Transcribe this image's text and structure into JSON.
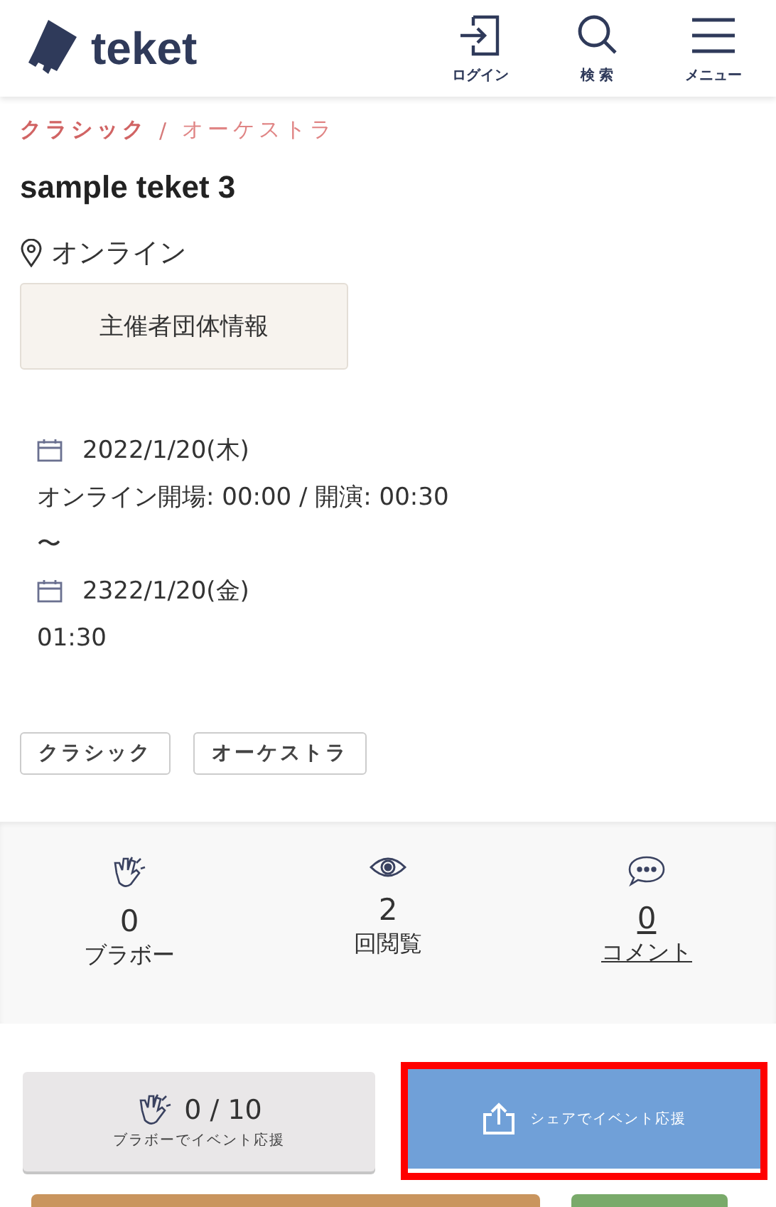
{
  "header": {
    "logo": "teket",
    "actions": [
      {
        "kind": "login",
        "label": "ログイン"
      },
      {
        "kind": "search",
        "label": "検 索"
      },
      {
        "kind": "menu",
        "label": "メニュー"
      }
    ]
  },
  "breadcrumb": [
    {
      "label": "クラシック",
      "current": false
    },
    {
      "label": "オーケストラ",
      "current": true
    }
  ],
  "breadcrumb_separator": "/",
  "title": "sample teket 3",
  "location": "オンライン",
  "organizer_button": "主催者団体情報",
  "schedule": [
    {
      "kind": "date",
      "text": "2022/1/20(木)"
    },
    {
      "kind": "text",
      "text": "オンライン開場: 00:00 / 開演: 00:30"
    },
    {
      "kind": "text",
      "text": "〜"
    },
    {
      "kind": "date",
      "text": "2322/1/20(金)"
    },
    {
      "kind": "text",
      "text": "01:30"
    }
  ],
  "tags": [
    "クラシック",
    "オーケストラ"
  ],
  "stats": [
    {
      "kind": "clap",
      "value": "0",
      "label": "ブラボー",
      "link": false
    },
    {
      "kind": "eye",
      "value": "2",
      "label": "回閲覧",
      "link": false
    },
    {
      "kind": "comment",
      "value": "0",
      "label": "コメント",
      "link": true
    }
  ],
  "actions": [
    {
      "kind": "bravo",
      "count": "0 / 10",
      "label": "ブラボーでイベント応援",
      "highlighted": false
    },
    {
      "kind": "share",
      "label": "シェアでイベント応援",
      "highlighted": true
    }
  ]
}
